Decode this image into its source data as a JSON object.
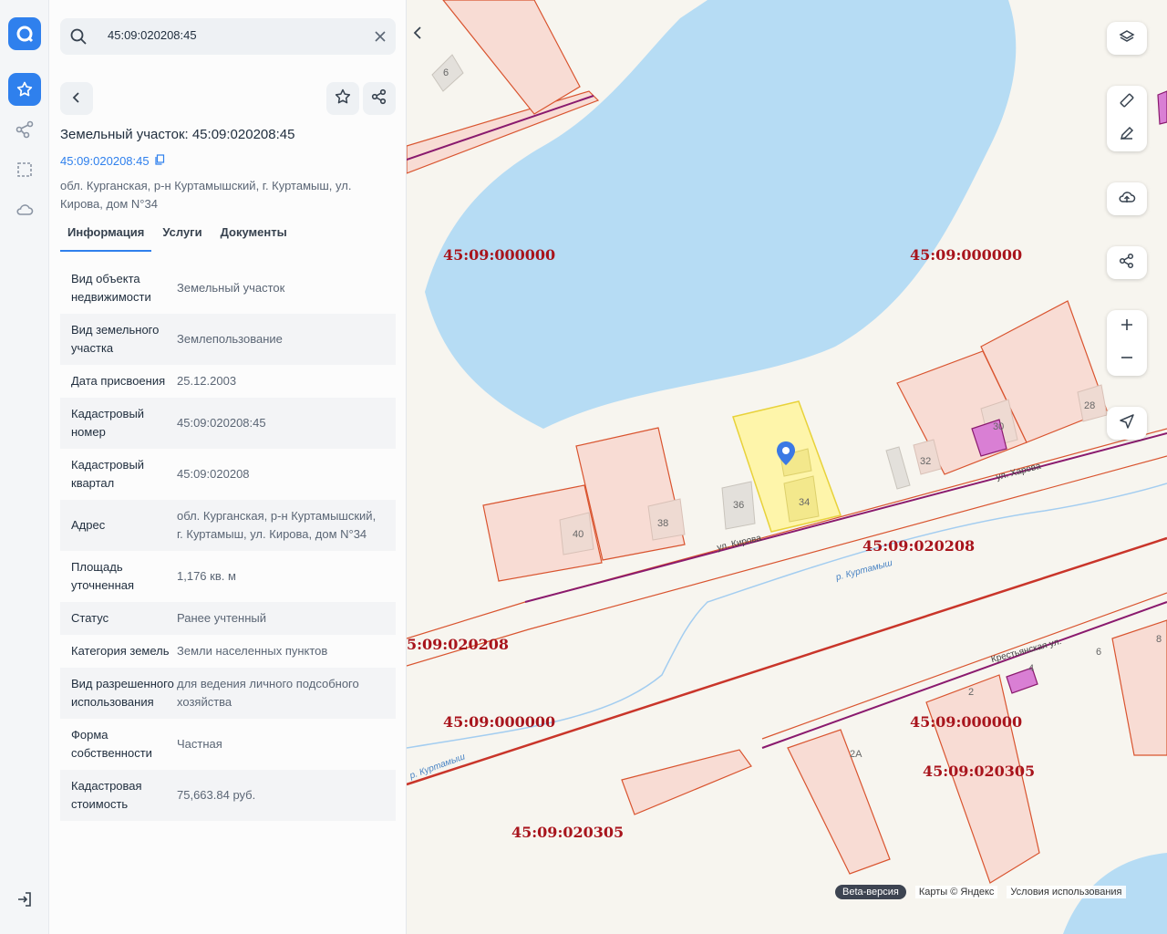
{
  "search": {
    "query": "45:09:020208:45",
    "icon": "search-icon",
    "clear_icon": "close-icon"
  },
  "parcel": {
    "title": "Земельный участок: 45:09:020208:45",
    "cadastral_link": "45:09:020208:45",
    "address": "обл. Курганская, р-н Куртамышский, г. Куртамыш, ул. Кирова, дом N°34"
  },
  "tabs": [
    {
      "label": "Информация",
      "active": true
    },
    {
      "label": "Услуги",
      "active": false
    },
    {
      "label": "Документы",
      "active": false
    }
  ],
  "info": [
    {
      "key": "Вид объекта недвижимости",
      "value": "Земельный участок"
    },
    {
      "key": "Вид земельного участка",
      "value": "Землепользование"
    },
    {
      "key": "Дата присвоения",
      "value": "25.12.2003"
    },
    {
      "key": "Кадастровый номер",
      "value": "45:09:020208:45"
    },
    {
      "key": "Кадастровый квартал",
      "value": "45:09:020208"
    },
    {
      "key": "Адрес",
      "value": "обл. Курганская, р-н Куртамышский, г. Куртамыш, ул. Кирова, дом N°34"
    },
    {
      "key": "Площадь уточненная",
      "value": "1,176 кв. м"
    },
    {
      "key": "Статус",
      "value": "Ранее учтенный"
    },
    {
      "key": "Категория земель",
      "value": "Земли населенных пунктов"
    },
    {
      "key": "Вид разрешенного использования",
      "value": "для ведения личного подсобного хозяйства"
    },
    {
      "key": "Форма собственности",
      "value": "Частная"
    },
    {
      "key": "Кадастровая стоимость",
      "value": "75,663.84 руб."
    }
  ],
  "map": {
    "quarter_labels": [
      "45:09:000000",
      "45:09:000000",
      "45:09:020208",
      "5:09:020208",
      "45:09:000000",
      "45:09:000000",
      "45:09:020305",
      "45:09:020305"
    ],
    "house_numbers": [
      "6",
      "40",
      "38",
      "36",
      "34",
      "32",
      "30",
      "28",
      "2",
      "2A",
      "6",
      "8",
      "4"
    ],
    "streets": {
      "kirova": "ул. Кирова",
      "kr": "Крестьянская ул.",
      "kh": "ул. Харова"
    },
    "river": "р. Куртамыш",
    "beta": "Beta-версия",
    "copyright": "Карты © Яндекс",
    "terms": "Условия использования"
  },
  "colors": {
    "accent": "#2f80ed",
    "parcel_fill": "#fff59d",
    "boundary": "#d9542f",
    "quarter_label": "#a8141c",
    "water": "#b6dcf4"
  },
  "icons": [
    "logo-icon",
    "star-icon",
    "route-icon",
    "select-area-icon",
    "cloud-icon",
    "logout-icon",
    "back-arrow-icon",
    "favorite-icon",
    "share-icon",
    "copy-icon",
    "layers-icon",
    "ruler-icon",
    "edit-icon",
    "upload-icon",
    "plus-icon",
    "minus-icon",
    "locate-icon",
    "location-pin-icon"
  ]
}
